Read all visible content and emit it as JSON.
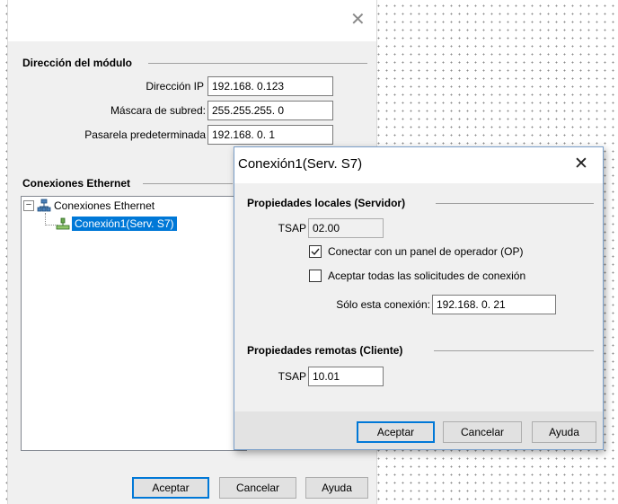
{
  "main_dialog": {
    "module_group_title": "Dirección del módulo",
    "ip_label": "Dirección IP",
    "ip_value": "192.168.  0.123",
    "mask_label": "Máscara de subred:",
    "mask_value": "255.255.255.  0",
    "gateway_label": "Pasarela predeterminada",
    "gateway_value": "192.168.  0.  1",
    "ethernet_group_title": "Conexiones Ethernet",
    "tree": {
      "root_label": "Conexiones Ethernet",
      "child_label": "Conexión1(Serv. S7)",
      "expander": "⊟"
    },
    "buttons": {
      "ok": "Aceptar",
      "cancel": "Cancelar",
      "help": "Ayuda"
    }
  },
  "connection_dialog": {
    "title": "Conexión1(Serv. S7)",
    "local_group_title": "Propiedades locales (Servidor)",
    "local_tsap_label": "TSAP",
    "local_tsap_value": "02.00",
    "op_checkbox": {
      "label": "Conectar con un panel de operador (OP)",
      "checked": true
    },
    "accept_all_checkbox": {
      "label": "Aceptar todas las solicitudes de conexión",
      "checked": false
    },
    "only_connection_label": "Sólo esta conexión:",
    "only_connection_value": "192.168.  0. 21",
    "remote_group_title": "Propiedades remotas (Cliente)",
    "remote_tsap_label": "TSAP",
    "remote_tsap_value": "10.01",
    "buttons": {
      "ok": "Aceptar",
      "cancel": "Cancelar",
      "help": "Ayuda"
    }
  },
  "colors": {
    "accent": "#0078d7",
    "dialog_bg": "#f0f0f0",
    "footer_bg": "#e3e3e3"
  },
  "icons": [
    "close-icon",
    "network-tree-icon",
    "connection-icon",
    "checkmark-icon"
  ]
}
